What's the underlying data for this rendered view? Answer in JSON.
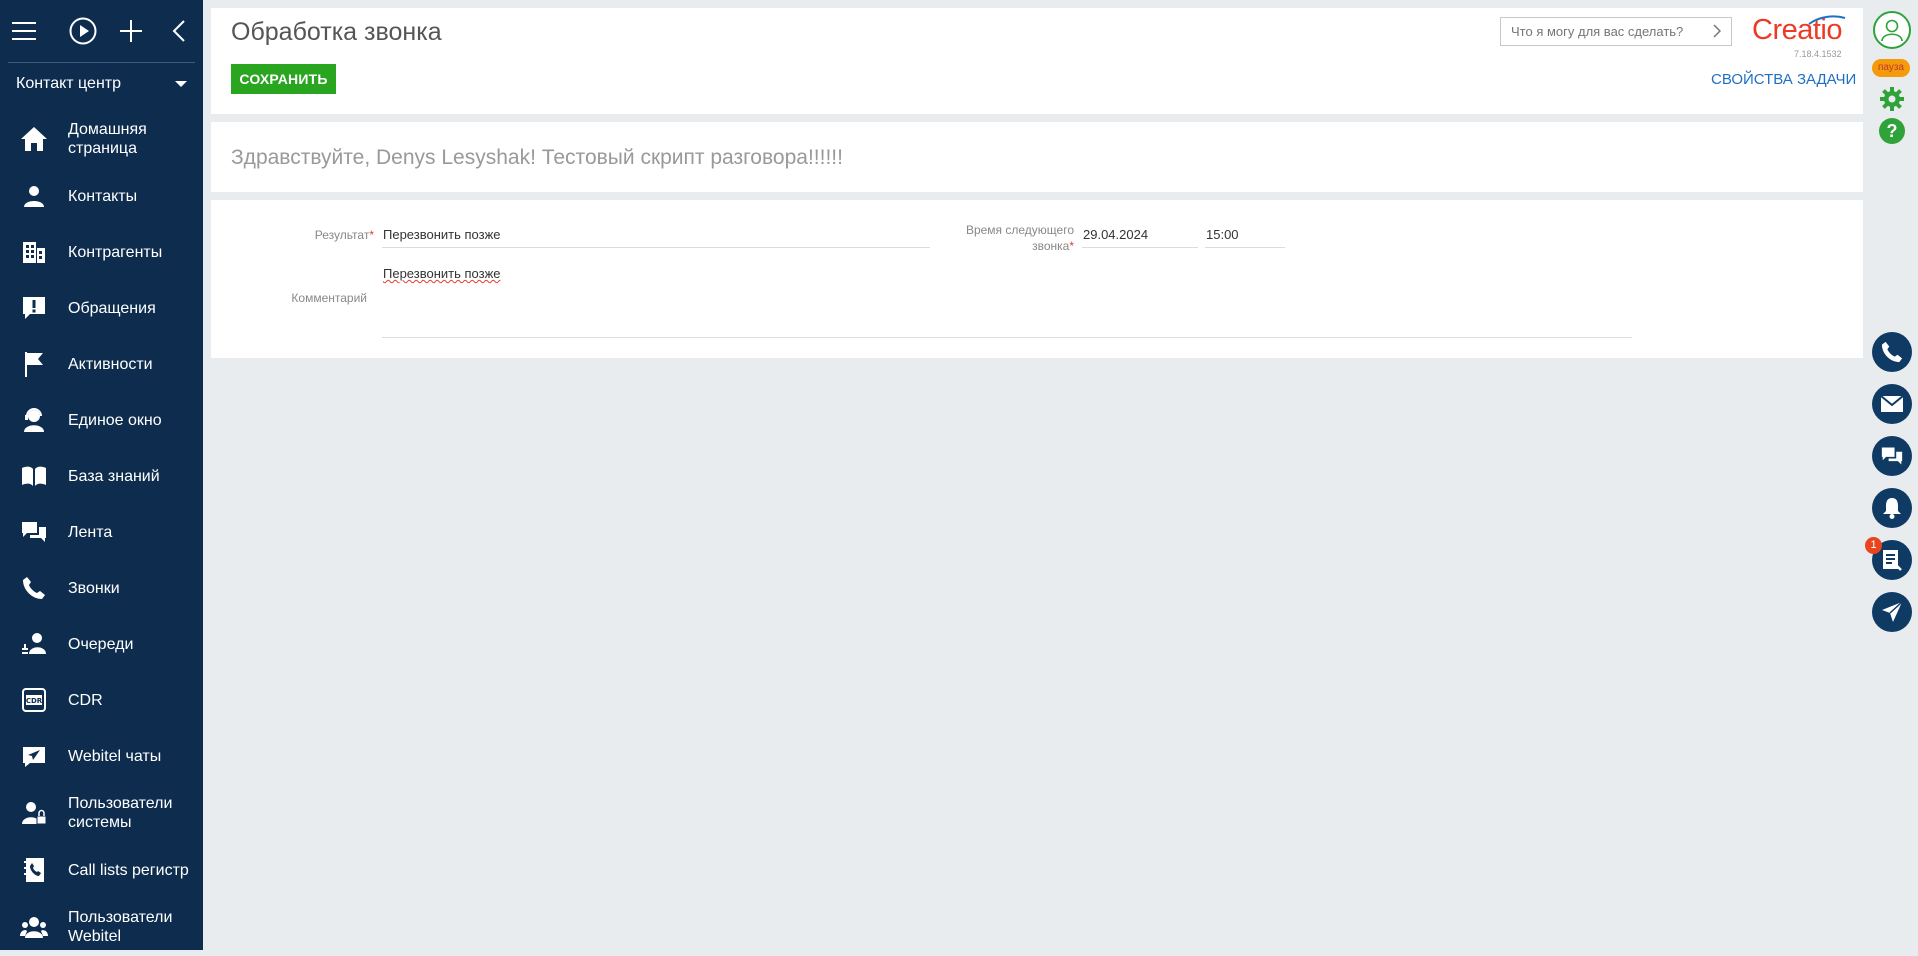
{
  "sidebar": {
    "section": "Контакт центр",
    "items": [
      {
        "label": "Домашняя страница",
        "icon": "home-icon"
      },
      {
        "label": "Контакты",
        "icon": "person-icon"
      },
      {
        "label": "Контрагенты",
        "icon": "building-icon"
      },
      {
        "label": "Обращения",
        "icon": "exclamation-chat-icon"
      },
      {
        "label": "Активности",
        "icon": "flag-icon"
      },
      {
        "label": "Единое окно",
        "icon": "headset-person-icon"
      },
      {
        "label": "База знаний",
        "icon": "book-icon"
      },
      {
        "label": "Лента",
        "icon": "chat-bubbles-icon"
      },
      {
        "label": "Звонки",
        "icon": "phone-icon"
      },
      {
        "label": "Очереди",
        "icon": "queue-person-icon"
      },
      {
        "label": "CDR",
        "icon": "cdr-icon"
      },
      {
        "label": "Webitel чаты",
        "icon": "paper-plane-icon"
      },
      {
        "label": "Пользователи системы",
        "icon": "user-lock-icon"
      },
      {
        "label": "Call lists регистр",
        "icon": "phone-book-icon"
      },
      {
        "label": "Пользователи Webitel",
        "icon": "users-group-icon"
      }
    ]
  },
  "header": {
    "title": "Обработка звонка",
    "save_label": "СОХРАНИТЬ",
    "search_placeholder": "Что я могу для вас сделать?",
    "logo": "Creatio",
    "version": "7.18.4.1532",
    "task_properties": "СВОЙСТВА ЗАДАЧИ"
  },
  "script": {
    "greeting": "Здравствуйте, Denys Lesyshak! Тестовый скрипт разговора!!!!!!"
  },
  "form": {
    "result_label": "Результат",
    "result_value": "Перезвонить позже",
    "next_call_label_1": "Время следующего",
    "next_call_label_2": "звонка",
    "next_call_date": "29.04.2024",
    "next_call_time": "15:00",
    "comment_label": "Комментарий",
    "comment_value": "Перезвонить позже",
    "required_mark": "*"
  },
  "rail": {
    "pause_label": "пауза",
    "notification_count": "1"
  },
  "colors": {
    "sidebar": "#0e2d4e",
    "save_button": "#29a51f",
    "accent_link": "#1f6fc3",
    "logo": "#ec3b25",
    "rail_button": "#0e3a64",
    "pause_badge": "#f59a0a"
  }
}
